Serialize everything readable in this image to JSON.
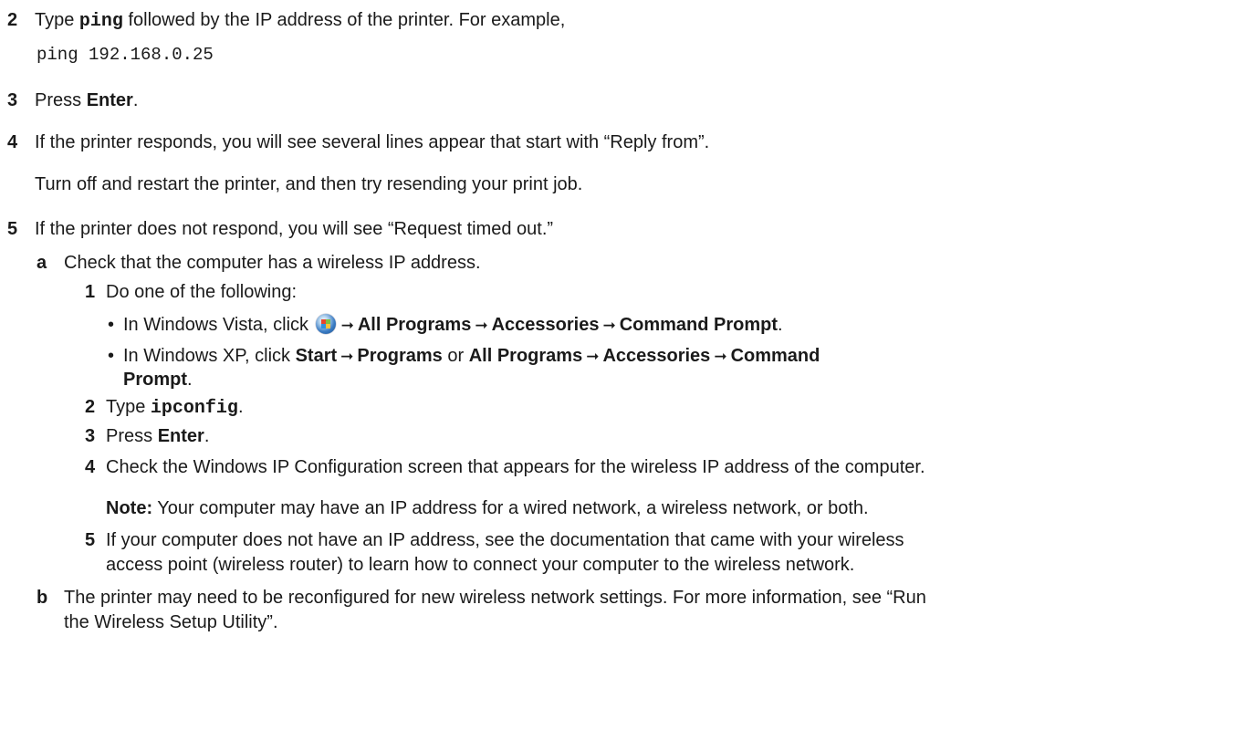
{
  "steps": {
    "s2": {
      "num": "2",
      "pre": "Type ",
      "cmd": "ping",
      "post": " followed by the IP address of the printer. For example,",
      "example": "ping 192.168.0.25"
    },
    "s3": {
      "num": "3",
      "pre": "Press ",
      "key": "Enter",
      "post": "."
    },
    "s4": {
      "num": "4",
      "text": "If the printer responds, you will see several lines appear that start with “Reply from”.",
      "follow": "Turn off and restart the printer, and then try resending your print job."
    },
    "s5": {
      "num": "5",
      "text": "If the printer does not respond, you will see “Request timed out.”"
    }
  },
  "sub_a": {
    "letter": "a",
    "text": "Check that the computer has a wireless IP address.",
    "i1": {
      "num": "1",
      "text": "Do one of the following:"
    },
    "vista": {
      "pre": "In Windows Vista, click ",
      "p1": "All Programs",
      "p2": "Accessories",
      "p3": "Command Prompt",
      "end": "."
    },
    "xp": {
      "pre": "In Windows XP, click ",
      "p1": "Start",
      "p2": "Programs",
      "or": " or ",
      "p3": "All Programs",
      "p4": "Accessories",
      "p5": "Command",
      "p6": "Prompt",
      "end": "."
    },
    "i2": {
      "num": "2",
      "pre": "Type ",
      "cmd": "ipconfig",
      "post": "."
    },
    "i3": {
      "num": "3",
      "pre": "Press ",
      "key": "Enter",
      "post": "."
    },
    "i4": {
      "num": "4",
      "text": "Check the Windows IP Configuration screen that appears for the wireless IP address of the computer.",
      "note_label": "Note:",
      "note_text": " Your computer may have an IP address for a wired network, a wireless network, or both."
    },
    "i5": {
      "num": "5",
      "line1": "If your computer does not have an IP address, see the documentation that came with your wireless",
      "line2": "access point (wireless router) to learn how to connect your computer to the wireless network."
    }
  },
  "sub_b": {
    "letter": "b",
    "line1": "The printer may need to be reconfigured for new wireless network settings. For more information, see “Run",
    "line2": "the Wireless Setup Utility”."
  },
  "arrow": "➞",
  "bullet": "•",
  "icons": {
    "windows_start": "windows-vista-start-orb-icon"
  }
}
